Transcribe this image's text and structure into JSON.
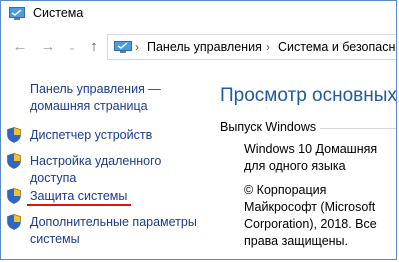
{
  "window": {
    "title": "Система"
  },
  "nav": {
    "breadcrumbs": [
      "Панель управления",
      "Система и безопасност"
    ]
  },
  "sidebar": {
    "home_link_line1": "Панель управления —",
    "home_link_line2": "домашняя страница",
    "items": [
      {
        "label_line1": "Диспетчер устройств",
        "label_line2": "",
        "icon": "shield-icon"
      },
      {
        "label_line1": "Настройка удаленного",
        "label_line2": "доступа",
        "icon": "shield-icon"
      },
      {
        "label_line1": "Защита системы",
        "label_line2": "",
        "icon": "shield-icon"
      },
      {
        "label_line1": "Дополнительные параметры",
        "label_line2": "системы",
        "icon": "shield-icon"
      }
    ]
  },
  "main": {
    "heading": "Просмотр основных свед",
    "section_title": "Выпуск Windows",
    "edition_line1": "Windows 10 Домашняя",
    "edition_line2": "для одного языка",
    "copyright_line1": "© Корпорация",
    "copyright_line2": "Майкрософт (Microsoft",
    "copyright_line3": "Corporation), 2018. Все",
    "copyright_line4": "права защищены."
  },
  "colors": {
    "link": "#1b3b8f",
    "heading": "#1e5aa0",
    "highlight": "#e01515",
    "border": "#5b8ac9"
  }
}
